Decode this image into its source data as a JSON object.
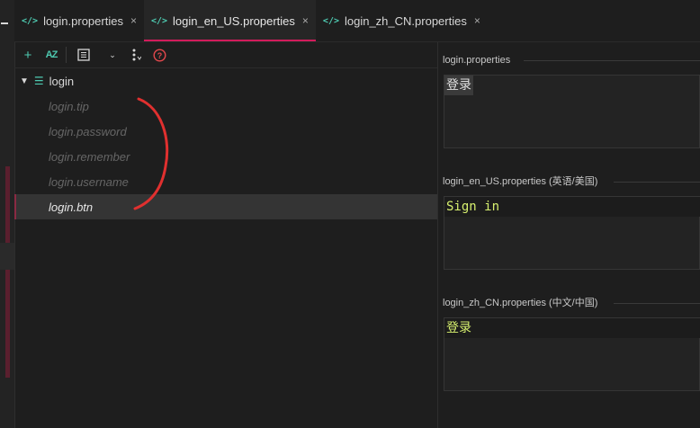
{
  "tabs": [
    {
      "icon": "code-icon",
      "label": "login.properties",
      "close": "×",
      "active": false
    },
    {
      "icon": "code-icon",
      "label": "login_en_US.properties",
      "close": "×",
      "active": true
    },
    {
      "icon": "code-icon",
      "label": "login_zh_CN.properties",
      "close": "×",
      "active": false
    }
  ],
  "toolbar": {
    "add": "+",
    "sort_az": "AZ",
    "help": "?"
  },
  "tree": {
    "root_label": "login",
    "items": [
      {
        "label": "login.tip"
      },
      {
        "label": "login.password"
      },
      {
        "label": "login.remember"
      },
      {
        "label": "login.username"
      },
      {
        "label": "login.btn",
        "selected": true
      }
    ]
  },
  "panels": [
    {
      "header": "login.properties",
      "value": "登录"
    },
    {
      "header": "login_en_US.properties (英语/美国)",
      "value": "Sign in"
    },
    {
      "header": "login_zh_CN.properties (中文/中国)",
      "value": "登录"
    }
  ],
  "colors": {
    "accent": "#d21c5b",
    "icon_teal": "#4ec9b0",
    "value_green": "#d7f06f",
    "annotation_red": "#e0302f"
  }
}
